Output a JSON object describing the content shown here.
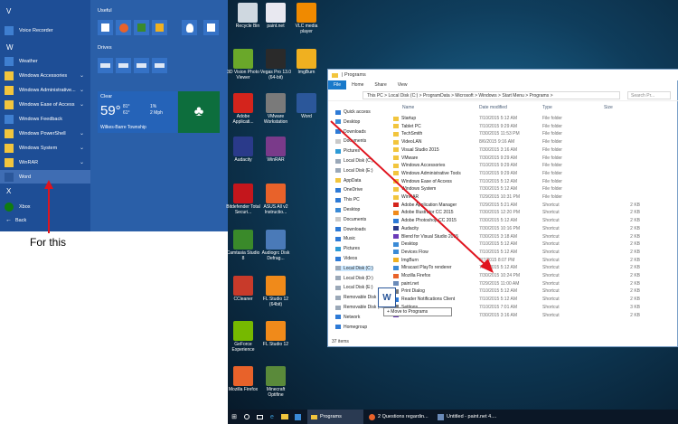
{
  "start_menu": {
    "headers": {
      "v": "V",
      "w": "W",
      "x": "X"
    },
    "items": [
      {
        "label": "Voice Recorder",
        "color": "#3f7fd0",
        "chevron": false
      },
      {
        "label": "Weather",
        "color": "#3f7fd0",
        "chevron": false
      },
      {
        "label": "Windows Accessories",
        "color": "#f2c53d",
        "chevron": true
      },
      {
        "label": "Windows Administrative...",
        "color": "#f2c53d",
        "chevron": true
      },
      {
        "label": "Windows Ease of Access",
        "color": "#f2c53d",
        "chevron": true
      },
      {
        "label": "Windows Feedback",
        "color": "#3f7fd0",
        "chevron": false
      },
      {
        "label": "Windows PowerShell",
        "color": "#f2c53d",
        "chevron": true
      },
      {
        "label": "Windows System",
        "color": "#f2c53d",
        "chevron": true
      },
      {
        "label": "WinRAR",
        "color": "#f2c53d",
        "chevron": true
      },
      {
        "label": "Word",
        "color": "#2b579a",
        "chevron": false
      }
    ],
    "xbox_label": "Xbox",
    "back_label": "Back",
    "groups": {
      "useful": "Useful",
      "drives": "Drives"
    },
    "weather": {
      "condition": "Clear",
      "temp": "59°",
      "high": "81°",
      "low": "61°",
      "precip": "1%",
      "wind": "2 Mph",
      "location": "Wilkes-Barre Township"
    }
  },
  "annotation": {
    "for_this": "For this"
  },
  "desktop_icons": [
    {
      "label": "Recycle Bin",
      "color": "#cfd8e0"
    },
    {
      "label": "paint.net",
      "color": "#e8e8f0"
    },
    {
      "label": "VLC media player",
      "color": "#f08a00"
    },
    {
      "label": "3D Vision Photo Viewer",
      "color": "#6aa82a"
    },
    {
      "label": "Vegas Pro 13.0 (64-bit)",
      "color": "#2a2a2a"
    },
    {
      "label": "ImgBurn",
      "color": "#f0b020"
    },
    {
      "label": "Adobe Applicati...",
      "color": "#d4241c"
    },
    {
      "label": "VMware Workstation",
      "color": "#7a7a7a"
    },
    {
      "label": "Word",
      "color": "#2b579a"
    },
    {
      "label": "Audacity",
      "color": "#2a3a8a"
    },
    {
      "label": "WinRAR",
      "color": "#7a3a8a"
    },
    {
      "label": "Bitdefender Total Securi...",
      "color": "#c4161c"
    },
    {
      "label": "ASUS All v2 Instructio...",
      "color": "#e8622a"
    },
    {
      "label": "Camtasia Studio 8",
      "color": "#3a8a2a"
    },
    {
      "label": "Audiogrc Disk Defrag...",
      "color": "#4a7ab8"
    },
    {
      "label": "CCleaner",
      "color": "#c83a2a"
    },
    {
      "label": "FL Studio 12 (64bit)",
      "color": "#f08a1a"
    },
    {
      "label": "GeForce Experience",
      "color": "#76b900"
    },
    {
      "label": "FL Studio 12",
      "color": "#f08a1a"
    },
    {
      "label": "Mozilla Firefox",
      "color": "#e8622a"
    },
    {
      "label": "Minecraft Optifine",
      "color": "#5a8a3a"
    }
  ],
  "explorer": {
    "title": "| Programs",
    "ribbon": [
      "File",
      "Home",
      "Share",
      "View"
    ],
    "address": "This PC > Local Disk (C:) > ProgramData > Microsoft > Windows > Start Menu > Programs >",
    "search_placeholder": "Search Pr...",
    "nav": [
      {
        "label": "Quick access",
        "color": "#2d7ad6"
      },
      {
        "label": "Desktop",
        "color": "#3a8ad6"
      },
      {
        "label": "Downloads",
        "color": "#2d7ad6"
      },
      {
        "label": "Documents",
        "color": "#c9c9c9"
      },
      {
        "label": "Pictures",
        "color": "#2d9ad6"
      },
      {
        "label": "Local Disk (C:)",
        "color": "#9aa8b8"
      },
      {
        "label": "Local Disk (E:)",
        "color": "#9aa8b8"
      },
      {
        "label": "AppData",
        "color": "#f2c53d"
      },
      {
        "label": "OneDrive",
        "color": "#2d7ad6"
      },
      {
        "label": "This PC",
        "color": "#2d7ad6"
      },
      {
        "label": "Desktop",
        "color": "#3a8ad6"
      },
      {
        "label": "Documents",
        "color": "#c9c9c9"
      },
      {
        "label": "Downloads",
        "color": "#2d7ad6"
      },
      {
        "label": "Music",
        "color": "#2d7ad6"
      },
      {
        "label": "Pictures",
        "color": "#2d9ad6"
      },
      {
        "label": "Videos",
        "color": "#2d7ad6"
      },
      {
        "label": "Local Disk (C:)",
        "color": "#9aa8b8"
      },
      {
        "label": "Local Disk (D:)",
        "color": "#9aa8b8"
      },
      {
        "label": "Local Disk (E:)",
        "color": "#9aa8b8"
      },
      {
        "label": "Removable Disk",
        "color": "#9aa8b8"
      },
      {
        "label": "Removable Disk (H:)",
        "color": "#9aa8b8"
      },
      {
        "label": "Network",
        "color": "#2d7ad6"
      },
      {
        "label": "Homegroup",
        "color": "#2d7ad6"
      }
    ],
    "columns": {
      "name": "Name",
      "date": "Date modified",
      "type": "Type",
      "size": "Size"
    },
    "files": [
      {
        "name": "Startup",
        "date": "7/10/2015 5:12 AM",
        "type": "File folder",
        "size": "",
        "color": "#f2c53d"
      },
      {
        "name": "Tablet PC",
        "date": "7/10/2015 9:29 AM",
        "type": "File folder",
        "size": "",
        "color": "#f2c53d"
      },
      {
        "name": "TechSmith",
        "date": "7/30/2015 11:53 PM",
        "type": "File folder",
        "size": "",
        "color": "#f2c53d"
      },
      {
        "name": "VideoLAN",
        "date": "8/6/2015 9:16 AM",
        "type": "File folder",
        "size": "",
        "color": "#f2c53d"
      },
      {
        "name": "Visual Studio 2015",
        "date": "7/30/2015 3:16 AM",
        "type": "File folder",
        "size": "",
        "color": "#f2c53d"
      },
      {
        "name": "VMware",
        "date": "7/30/2015 9:29 AM",
        "type": "File folder",
        "size": "",
        "color": "#f2c53d"
      },
      {
        "name": "Windows Accessories",
        "date": "7/10/2015 9:29 AM",
        "type": "File folder",
        "size": "",
        "color": "#f2c53d"
      },
      {
        "name": "Windows Administrative Tools",
        "date": "7/10/2015 9:29 AM",
        "type": "File folder",
        "size": "",
        "color": "#f2c53d"
      },
      {
        "name": "Windows Ease of Access",
        "date": "7/10/2015 5:12 AM",
        "type": "File folder",
        "size": "",
        "color": "#f2c53d"
      },
      {
        "name": "Windows System",
        "date": "7/30/2015 5:12 AM",
        "type": "File folder",
        "size": "",
        "color": "#f2c53d"
      },
      {
        "name": "WinRAR",
        "date": "7/29/2015 10:31 PM",
        "type": "File folder",
        "size": "",
        "color": "#f2c53d"
      },
      {
        "name": "Adobe Application Manager",
        "date": "7/29/2015 5:21 AM",
        "type": "Shortcut",
        "size": "2 KB",
        "color": "#d4241c"
      },
      {
        "name": "Adobe Illustrator CC 2015",
        "date": "7/30/2015 12:20 PM",
        "type": "Shortcut",
        "size": "2 KB",
        "color": "#f08a1a"
      },
      {
        "name": "Adobe Photoshop CC 2015",
        "date": "7/30/2015 5:12 AM",
        "type": "Shortcut",
        "size": "2 KB",
        "color": "#2d7ad6"
      },
      {
        "name": "Audacity",
        "date": "7/30/2015 10:16 PM",
        "type": "Shortcut",
        "size": "2 KB",
        "color": "#2a3a8a"
      },
      {
        "name": "Blend for Visual Studio 2015",
        "date": "7/30/2015 3:18 AM",
        "type": "Shortcut",
        "size": "2 KB",
        "color": "#6a3ab8"
      },
      {
        "name": "Desktop",
        "date": "7/10/2015 5:12 AM",
        "type": "Shortcut",
        "size": "2 KB",
        "color": "#3a8ad6"
      },
      {
        "name": "Devices Flow",
        "date": "7/10/2015 5:12 AM",
        "type": "Shortcut",
        "size": "2 KB",
        "color": "#3a8ad6"
      },
      {
        "name": "ImgBurn",
        "date": "8/7/2015 8:07 PM",
        "type": "Shortcut",
        "size": "2 KB",
        "color": "#f0b020"
      },
      {
        "name": "Miracast PlayTo renderer",
        "date": "7/10/2015 5:12 AM",
        "type": "Shortcut",
        "size": "2 KB",
        "color": "#3a8ad6"
      },
      {
        "name": "Mozilla Firefox",
        "date": "7/30/2015 10:24 PM",
        "type": "Shortcut",
        "size": "2 KB",
        "color": "#e8622a"
      },
      {
        "name": "paint.net",
        "date": "7/29/2015 11:00 AM",
        "type": "Shortcut",
        "size": "2 KB",
        "color": "#6a8ab8"
      },
      {
        "name": "Print Dialog",
        "date": "7/10/2015 5:12 AM",
        "type": "Shortcut",
        "size": "2 KB",
        "color": "#7a7a7a"
      },
      {
        "name": "Reader Notifications Client",
        "date": "7/10/2015 5:12 AM",
        "type": "Shortcut",
        "size": "2 KB",
        "color": "#2d7ad6"
      },
      {
        "name": "Settings",
        "date": "7/10/2015 7:01 AM",
        "type": "Shortcut",
        "size": "3 KB",
        "color": "#7a7a7a"
      },
      {
        "name": "Visual Studio 2015",
        "date": "7/30/2015 3:16 AM",
        "type": "Shortcut",
        "size": "2 KB",
        "color": "#6a3ab8"
      }
    ],
    "status": "37 items",
    "drag_tooltip": "+ Move to Programs"
  },
  "taskbar": {
    "items": [
      "Programs",
      "2 Questions regardin...",
      "Untitled - paint.net 4...."
    ]
  },
  "colors": {
    "start_bg": "#2a5fa8",
    "arrow": "#e0141e",
    "taskbar": "#0b1726"
  }
}
